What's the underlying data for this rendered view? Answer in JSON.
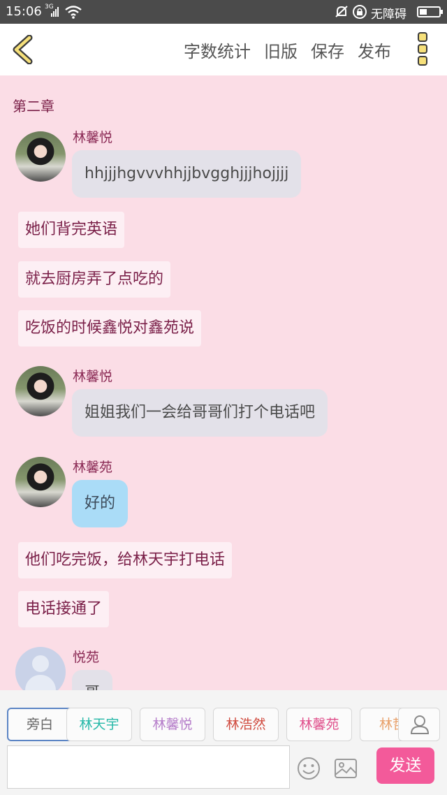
{
  "status_bar": {
    "time": "15:06",
    "network": "3G",
    "accessibility": "无障碍",
    "battery_level": 0.4
  },
  "top_bar": {
    "actions": [
      "字数统计",
      "旧版",
      "保存",
      "发布"
    ]
  },
  "chapter_title": "第二章",
  "messages": [
    {
      "type": "dialogue",
      "speaker": "林馨悦",
      "text": "hhjjjhgvvvhhjjbvgghjjjhojjjj",
      "avatar": "photo"
    },
    {
      "type": "narration",
      "text": "她们背完英语"
    },
    {
      "type": "narration",
      "text": "就去厨房弄了点吃的"
    },
    {
      "type": "narration",
      "text": "吃饭的时候鑫悦对鑫苑说"
    },
    {
      "type": "dialogue",
      "speaker": "林馨悦",
      "text": "姐姐我们一会给哥哥们打个电话吧",
      "avatar": "photo"
    },
    {
      "type": "dialogue",
      "speaker": "林馨苑",
      "text": "好的",
      "avatar": "photo",
      "bubble_color": "#aadcf7"
    },
    {
      "type": "narration",
      "text": "他们吃完饭，给林天宇打电话"
    },
    {
      "type": "narration",
      "text": "电话接通了"
    },
    {
      "type": "dialogue",
      "speaker": "悦苑",
      "text": "哥",
      "avatar": "default"
    }
  ],
  "characters": [
    {
      "name": "旁白",
      "color": "#666666",
      "active": true
    },
    {
      "name": "林天宇",
      "color": "#26b8a8"
    },
    {
      "name": "林馨悦",
      "color": "#b57cc9"
    },
    {
      "name": "林浩然",
      "color": "#d04b3f"
    },
    {
      "name": "林馨苑",
      "color": "#e0508c"
    },
    {
      "name": "林哲",
      "color": "#e8a06a"
    }
  ],
  "input": {
    "value": "",
    "placeholder": ""
  },
  "send_label": "发送",
  "icons": {
    "back": "back-chevron-icon",
    "menu": "more-menu-icon",
    "emoji": "emoji-icon",
    "image": "image-icon",
    "character": "user-icon"
  }
}
